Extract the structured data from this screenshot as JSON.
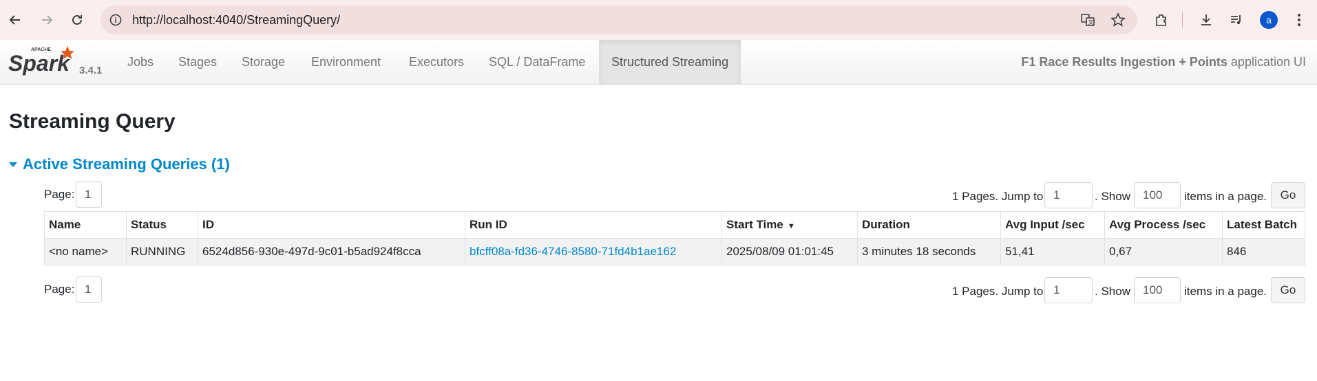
{
  "browser": {
    "url": "http://localhost:4040/StreamingQuery/",
    "profile_initial": "a"
  },
  "spark": {
    "version": "3.4.1",
    "nav": [
      "Jobs",
      "Stages",
      "Storage",
      "Environment",
      "Executors",
      "SQL / DataFrame",
      "Structured Streaming"
    ],
    "active_nav": "Structured Streaming",
    "app_name": "F1 Race Results Ingestion + Points",
    "app_suffix": "application UI"
  },
  "page": {
    "title": "Streaming Query",
    "section_title": "Active Streaming Queries (1)"
  },
  "pager": {
    "page_label": "Page:",
    "page_value": "1",
    "pages_text": "1 Pages. Jump to",
    "jump_value": "1",
    "show_text": ". Show",
    "show_value": "100",
    "items_text": "items in a page.",
    "go_label": "Go"
  },
  "table": {
    "headers": [
      "Name",
      "Status",
      "ID",
      "Run ID",
      "Start Time",
      "Duration",
      "Avg Input /sec",
      "Avg Process /sec",
      "Latest Batch"
    ],
    "sort_indicator": "▼",
    "rows": [
      {
        "name": "<no name>",
        "status": "RUNNING",
        "id": "6524d856-930e-497d-9c01-b5ad924f8cca",
        "run_id": "bfcff08a-fd36-4746-8580-71fd4b1ae162",
        "start_time": "2025/08/09 01:01:45",
        "duration": "3 minutes 18 seconds",
        "avg_input": "51,41",
        "avg_process": "0,67",
        "latest_batch": "846"
      }
    ]
  }
}
